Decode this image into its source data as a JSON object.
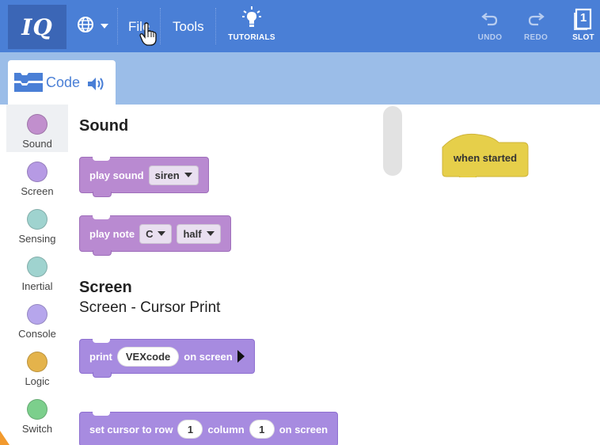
{
  "topbar": {
    "logo": "IQ",
    "menu": {
      "file": "File",
      "tools": "Tools"
    },
    "tutorials": "TUTORIALS",
    "undo": "UNDO",
    "redo": "REDO",
    "slot": "SLOT",
    "slot_number": "1",
    "icons": {
      "language": "globe-icon",
      "tutorials": "lightbulb-icon",
      "undo": "undo-icon",
      "redo": "redo-icon",
      "slot": "slot-icon"
    }
  },
  "tab": {
    "label": "Code",
    "icons": [
      "blocks-icon",
      "speaker-icon"
    ]
  },
  "categories": [
    {
      "label": "Sound",
      "color": "#c18fcd",
      "selected": true
    },
    {
      "label": "Screen",
      "color": "#b69ae4"
    },
    {
      "label": "Sensing",
      "color": "#9fd3cf"
    },
    {
      "label": "Inertial",
      "color": "#9fd3cf"
    },
    {
      "label": "Console",
      "color": "#b6a6ec"
    },
    {
      "label": "Logic",
      "color": "#e4b34b"
    },
    {
      "label": "Switch",
      "color": "#7ccf8c"
    }
  ],
  "flyout": {
    "sound_heading": "Sound",
    "play_sound": {
      "label": "play sound",
      "value": "siren"
    },
    "play_note": {
      "label": "play note",
      "note": "C",
      "duration": "half"
    },
    "screen_heading": "Screen",
    "screen_sub": "Screen - Cursor Print",
    "print_block": {
      "label": "print",
      "value": "VEXcode",
      "suffix": "on screen"
    },
    "cursor_block": {
      "label": "set cursor to row",
      "row": "1",
      "column_label": "column",
      "column": "1",
      "suffix": "on screen"
    }
  },
  "workspace": {
    "hat_block": "when started"
  },
  "colors": {
    "topbar": "#4a7fd6",
    "tabstrip": "#9bbde8",
    "sound_block": "#b98ad1",
    "screen_block": "#a78be0",
    "hat_block": "#e6cf4a"
  }
}
